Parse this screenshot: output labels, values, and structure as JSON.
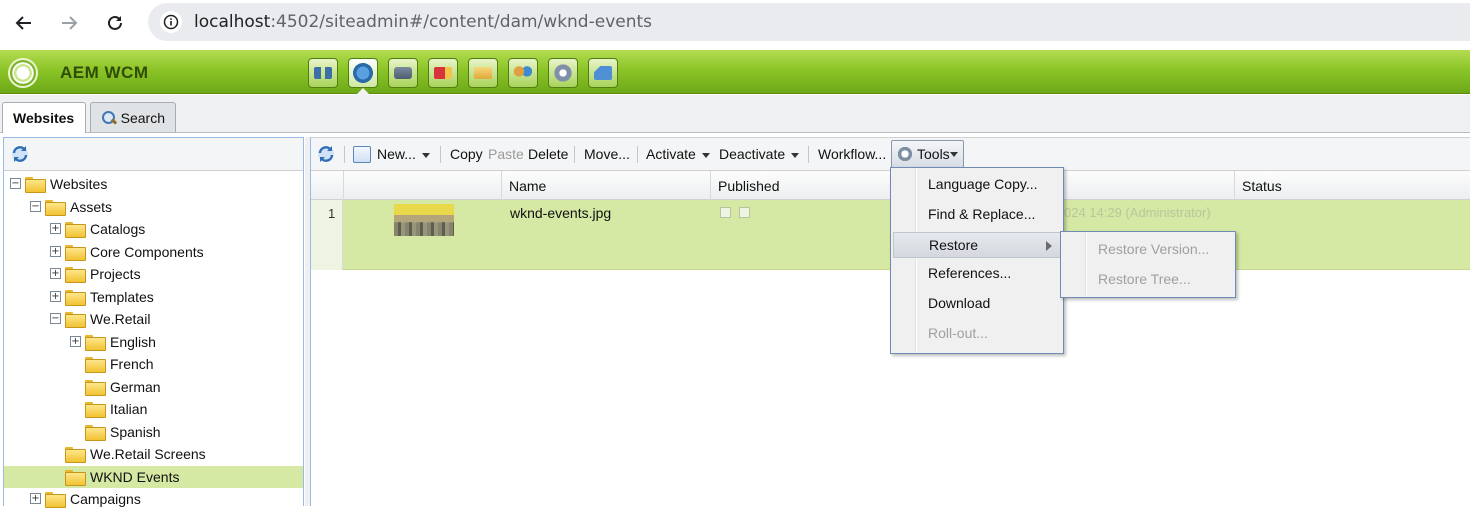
{
  "browser": {
    "url_host": "localhost",
    "url_rest": ":4502/siteadmin#/content/dam/wknd-events"
  },
  "app": {
    "title": "AEM WCM",
    "icons": [
      "sitemap-icon",
      "websites-icon",
      "dam-icon",
      "campaigns-icon",
      "inbox-icon",
      "users-icon",
      "tools-icon",
      "tagging-icon"
    ],
    "accent": "#8cc528"
  },
  "tabs": [
    {
      "label": "Websites",
      "active": true
    },
    {
      "label": "Search",
      "active": false
    }
  ],
  "tree": [
    {
      "label": "Websites",
      "depth": 0,
      "toggle": "-"
    },
    {
      "label": "Assets",
      "depth": 1,
      "toggle": "-"
    },
    {
      "label": "Catalogs",
      "depth": 2,
      "toggle": "+"
    },
    {
      "label": "Core Components",
      "depth": 2,
      "toggle": "+"
    },
    {
      "label": "Projects",
      "depth": 2,
      "toggle": "+"
    },
    {
      "label": "Templates",
      "depth": 2,
      "toggle": "+"
    },
    {
      "label": "We.Retail",
      "depth": 2,
      "toggle": "-"
    },
    {
      "label": "English",
      "depth": 3,
      "toggle": "+"
    },
    {
      "label": "French",
      "depth": 3,
      "toggle": ""
    },
    {
      "label": "German",
      "depth": 3,
      "toggle": ""
    },
    {
      "label": "Italian",
      "depth": 3,
      "toggle": ""
    },
    {
      "label": "Spanish",
      "depth": 3,
      "toggle": ""
    },
    {
      "label": "We.Retail Screens",
      "depth": 2,
      "toggle": ""
    },
    {
      "label": "WKND Events",
      "depth": 2,
      "toggle": "",
      "selected": true
    },
    {
      "label": "Campaigns",
      "depth": 1,
      "toggle": "+"
    }
  ],
  "toolbar": {
    "new": "New...",
    "copy": "Copy",
    "paste": "Paste",
    "delete": "Delete",
    "move": "Move...",
    "activate": "Activate",
    "deactivate": "Deactivate",
    "workflow": "Workflow...",
    "tools": "Tools"
  },
  "grid": {
    "columns": [
      "Name",
      "Published",
      "Status"
    ],
    "rows": [
      {
        "num": "1",
        "name": "wknd-events.jpg",
        "modified_partial": "024 14:29 (Administrator)"
      }
    ]
  },
  "tools_menu": [
    {
      "label": "Language Copy...",
      "disabled": false
    },
    {
      "label": "Find & Replace...",
      "disabled": false
    },
    {
      "label": "Restore",
      "disabled": false,
      "submenu": true,
      "hover": true
    },
    {
      "label": "References...",
      "disabled": false
    },
    {
      "label": "Download",
      "disabled": false
    },
    {
      "label": "Roll-out...",
      "disabled": true
    }
  ],
  "restore_submenu": [
    {
      "label": "Restore Version...",
      "disabled": true
    },
    {
      "label": "Restore Tree...",
      "disabled": true
    }
  ]
}
